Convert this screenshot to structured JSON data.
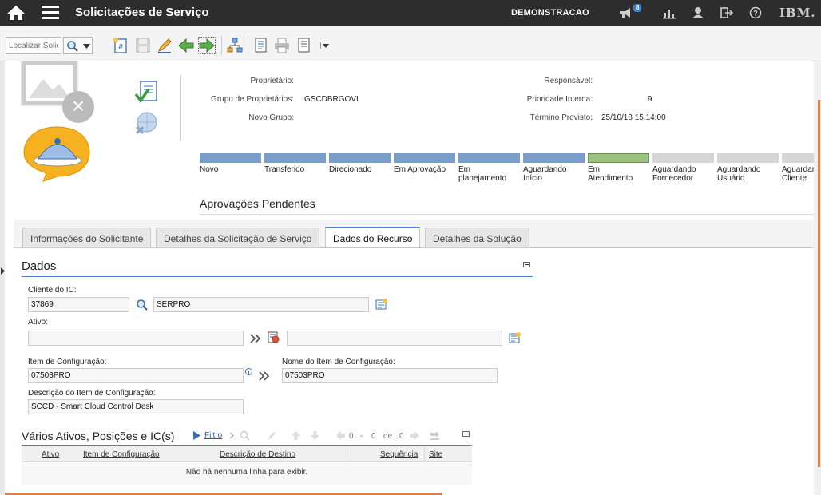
{
  "app": {
    "title": "Solicitações de Serviço",
    "user": "DEMONSTRACAO",
    "notifications_count": "8",
    "vendor": "IBM."
  },
  "toolbar": {
    "search_placeholder": "Localizar Solic"
  },
  "header": {
    "fields": {
      "owner_label": "Proprietário:",
      "owner_value": "",
      "owner_group_label": "Grupo de Proprietários:",
      "owner_group_value": "GSCDBRGOVI",
      "new_group_label": "Novo Grupo:",
      "new_group_value": "",
      "responsible_label": "Responsável:",
      "responsible_value": "",
      "internal_priority_label": "Prioridade Interna:",
      "internal_priority_value": "9",
      "expected_end_label": "Término Previsto:",
      "expected_end_value": "25/10/18 15:14:00"
    },
    "statuses": [
      {
        "label": "Novo",
        "state": "done"
      },
      {
        "label": "Transferido",
        "state": "done"
      },
      {
        "label": "Direcionado",
        "state": "done"
      },
      {
        "label": "Em Aprovação",
        "state": "done"
      },
      {
        "label": "Em planejamento",
        "state": "done"
      },
      {
        "label": "Aguardando Início",
        "state": "done"
      },
      {
        "label": "Em Atendimento",
        "state": "current"
      },
      {
        "label": "Aguardando Fornecedor",
        "state": "future"
      },
      {
        "label": "Aguardando Usuário",
        "state": "future"
      },
      {
        "label": "Aguardando Cliente",
        "state": "future"
      }
    ],
    "pending_approvals": "Aprovações Pendentes"
  },
  "tabs": [
    {
      "label": "Informações do Solicitante",
      "active": false
    },
    {
      "label": "Detalhes da Solicitação de Serviço",
      "active": false
    },
    {
      "label": "Dados do Recurso",
      "active": true
    },
    {
      "label": "Detalhes da Solução",
      "active": false
    }
  ],
  "dados": {
    "title": "Dados",
    "ci_client_label": "Cliente do IC:",
    "ci_client_code": "37869",
    "ci_client_name": "SERPRO",
    "asset_label": "Ativo:",
    "asset_value": "",
    "asset_desc": "",
    "ci_label": "Item de Configuração:",
    "ci_value": "07503PRO",
    "ci_name_label": "Nome do Item de Configuração:",
    "ci_name_value": "07503PRO",
    "ci_desc_label": "Descrição do Item de Configuração:",
    "ci_desc_value": "SCCD - Smart Cloud Control Desk"
  },
  "multi_assets": {
    "title": "Vários Ativos, Posições e IC(s)",
    "filter_label": "Filtro",
    "pager_from": "0",
    "pager_dash": "-",
    "pager_to": "0",
    "pager_of": "de",
    "pager_total": "0",
    "columns": [
      "Ativo",
      "Item de Configuração",
      "Descrição de Destino",
      "Sequência",
      "Site"
    ],
    "empty_message": "Não há nenhuma linha para exibir."
  },
  "colors": {
    "status_done": "#7b9dc9",
    "status_current": "#9ac27e",
    "status_future": "#d6d6d6",
    "accent": "#4a80c8",
    "orange": "#e87c3e"
  }
}
